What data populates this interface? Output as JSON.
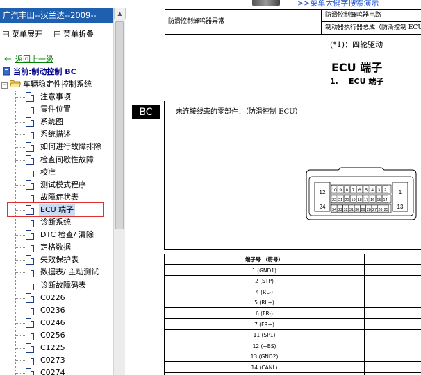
{
  "sidebar": {
    "title": "广汽丰田--汉兰达--2009--",
    "menu_expand": "菜单展开",
    "menu_collapse": "菜单折叠",
    "back_label": "返回上一级",
    "current_label": "当前:制动控制 BC",
    "folder_label": "车辆稳定性控制系统",
    "items": [
      {
        "label": "注意事项"
      },
      {
        "label": "零件位置"
      },
      {
        "label": "系统图"
      },
      {
        "label": "系统描述"
      },
      {
        "label": "如何进行故障排除"
      },
      {
        "label": "检查间歇性故障"
      },
      {
        "label": "校准"
      },
      {
        "label": "测试模式程序"
      },
      {
        "label": "故障症状表"
      },
      {
        "label": "ECU 端子"
      },
      {
        "label": "诊断系统"
      },
      {
        "label": "DTC 检查/ 清除"
      },
      {
        "label": "定格数据"
      },
      {
        "label": "失效保护表"
      },
      {
        "label": "数据表/ 主动测试"
      },
      {
        "label": "诊断故障码表"
      },
      {
        "label": "C0226"
      },
      {
        "label": "C0236"
      },
      {
        "label": "C0246"
      },
      {
        "label": "C0256"
      },
      {
        "label": "C1225"
      },
      {
        "label": "C0273"
      },
      {
        "label": "C0274"
      }
    ],
    "selected_index": 9
  },
  "document": {
    "top_link": ">>菜单大健字搜索演示",
    "header_left": "防滑控制蜂鸣器异常",
    "header_right_top": "防滑控制蜂鸣器电路",
    "header_right_bottom": "制动器执行器总成（防滑控制 ECU",
    "drive_note": "(*1)：四轮驱动",
    "heading": "ECU 端子",
    "subheading_num": "1.",
    "subheading": "ECU 端子",
    "section_tag": "BC",
    "connector_caption": "未连接线束的零部件：（防滑控制 ECU）",
    "connector": {
      "top_row": [
        "12",
        "11",
        "10",
        "9",
        "8",
        "7",
        "6",
        "5",
        "4",
        "3",
        "2",
        "1"
      ],
      "bottom_row": [
        "24",
        "23",
        "22",
        "21",
        "20",
        "19",
        "18",
        "17",
        "16",
        "15",
        "14",
        "13"
      ],
      "inner_top": [
        "10",
        "9",
        "8",
        "7",
        "6",
        "5",
        "4",
        "3",
        "2"
      ],
      "inner_mid": [
        "22",
        "21",
        "20",
        "19",
        "18",
        "17",
        "16",
        "15",
        "14"
      ],
      "inner_bot": [
        "34",
        "33",
        "32",
        "31",
        "30",
        "29",
        "28",
        "27",
        "26",
        "25"
      ]
    },
    "pin_table": {
      "header": "端子号 （符号）",
      "rows": [
        "1 (GND1)",
        "2 (STP)",
        "4 (RL-)",
        "5 (RL+)",
        "6 (FR-)",
        "7 (FR+)",
        "11 (SP1)",
        "12 (+BS)",
        "13 (GND2)",
        "14 (CANL)"
      ]
    }
  }
}
